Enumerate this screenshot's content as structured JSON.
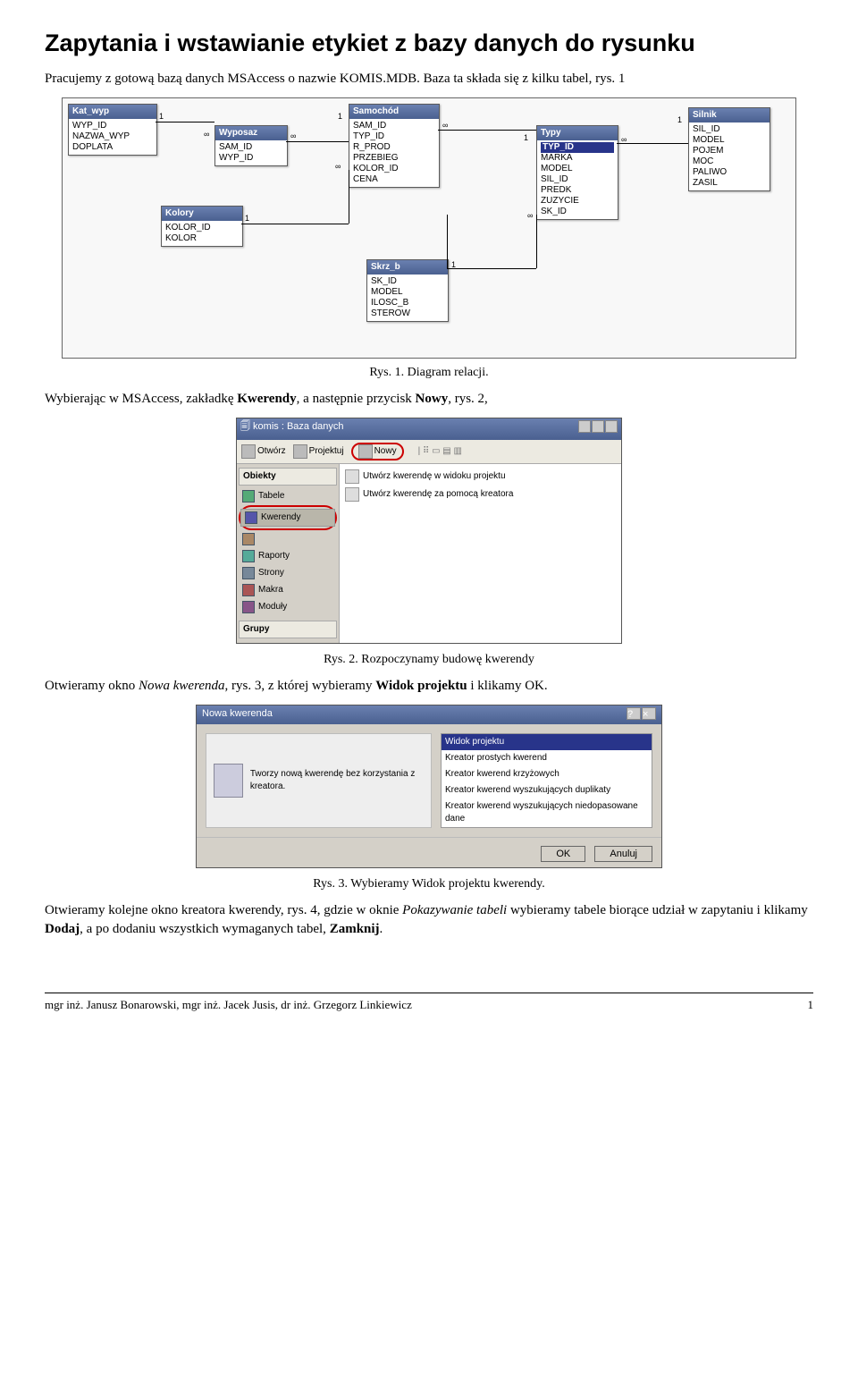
{
  "title": "Zapytania i wstawianie etykiet z bazy danych do rysunku",
  "intro": {
    "a": "Pracujemy z gotową bazą danych MSAccess o nazwie KOMIS.MDB. Baza ta składa się z kilku tabel, rys. 1",
    "caption1": "Rys. 1. Diagram relacji.",
    "b1": "Wybierając w MSAccess, zakładkę ",
    "b_bold1": "Kwerendy",
    "b2": ", a następnie przycisk ",
    "b_bold2": "Nowy",
    "b3": ", rys. 2,",
    "caption2": "Rys. 2. Rozpoczynamy budowę kwerendy",
    "c1": "Otwieramy okno ",
    "c_it1": "Nowa kwerenda",
    "c2": ", rys. 3, z której wybieramy ",
    "c_bold1": "Widok projektu",
    "c3": " i klikamy OK.",
    "caption3": "Rys. 3. Wybieramy Widok projektu kwerendy.",
    "d1": "Otwieramy kolejne okno kreatora kwerendy, rys. 4, gdzie w oknie ",
    "d_it1": "Pokazywanie tabeli",
    "d2": " wybieramy tabele biorące udział w zapytaniu i klikamy ",
    "d_bold1": "Dodaj",
    "d3": ", a po dodaniu wszystkich wymaganych tabel, ",
    "d_bold2": "Zamknij",
    "d4": "."
  },
  "diagram": {
    "tables": {
      "kat_wyp": {
        "title": "Kat_wyp",
        "rows": [
          "WYP_ID",
          "NAZWA_WYP",
          "DOPLATA"
        ]
      },
      "wyposaz": {
        "title": "Wyposaz",
        "rows": [
          "SAM_ID",
          "WYP_ID"
        ]
      },
      "kolory": {
        "title": "Kolory",
        "rows": [
          "KOLOR_ID",
          "KOLOR"
        ]
      },
      "samochod": {
        "title": "Samochód",
        "rows": [
          "SAM_ID",
          "TYP_ID",
          "R_PROD",
          "PRZEBIEG",
          "KOLOR_ID",
          "CENA"
        ]
      },
      "skrz_b": {
        "title": "Skrz_b",
        "rows": [
          "SK_ID",
          "MODEL",
          "ILOSC_B",
          "STEROW"
        ]
      },
      "typy": {
        "title": "Typy",
        "rows": [
          "TYP_ID",
          "MARKA",
          "MODEL",
          "SIL_ID",
          "PREDK",
          "ZUZYCIE",
          "SK_ID"
        ],
        "sel": "TYP_ID"
      },
      "silnik": {
        "title": "Silnik",
        "rows": [
          "SIL_ID",
          "MODEL",
          "POJEM",
          "MOC",
          "PALIWO",
          "ZASIL"
        ]
      }
    },
    "labels": {
      "one": "1",
      "inf": "∞"
    }
  },
  "fig2": {
    "titlebar": "komis : Baza danych",
    "toolbar": {
      "otworz": "Otwórz",
      "projektuj": "Projektuj",
      "nowy": "Nowy"
    },
    "sidebar": {
      "head": "Obiekty",
      "items": [
        "Tabele",
        "Kwerendy",
        "",
        "Raporty",
        "Strony",
        "Makra",
        "Moduły"
      ],
      "foot": "Grupy"
    },
    "main": {
      "item1": "Utwórz kwerendę w widoku projektu",
      "item2": "Utwórz kwerendę za pomocą kreatora"
    }
  },
  "fig3": {
    "title": "Nowa kwerenda",
    "left_text": "Tworzy nową kwerendę bez korzystania z kreatora.",
    "list": [
      "Widok projektu",
      "Kreator prostych kwerend",
      "Kreator kwerend krzyżowych",
      "Kreator kwerend wyszukujących duplikaty",
      "Kreator kwerend wyszukujących niedopasowane dane"
    ],
    "ok": "OK",
    "anuluj": "Anuluj"
  },
  "footer": {
    "left": "mgr inż. Janusz Bonarowski, mgr inż. Jacek Jusis, dr inż. Grzegorz Linkiewicz",
    "right": "1"
  }
}
